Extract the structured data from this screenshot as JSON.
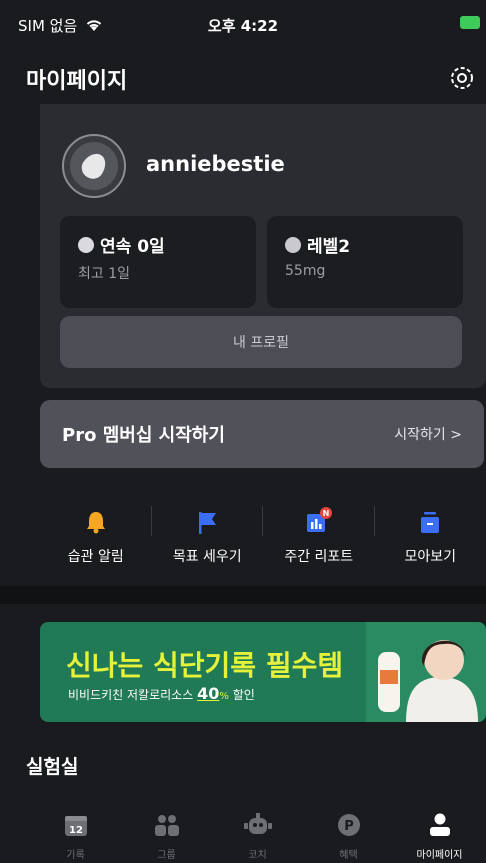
{
  "status": {
    "carrier": "SIM 없음",
    "time": "오후 4:22"
  },
  "header": {
    "title": "마이페이지"
  },
  "profile": {
    "username": "anniebestie",
    "streak": {
      "label": "연속 0일",
      "sub": "최고 1일"
    },
    "level": {
      "label": "레벨2",
      "sub": "55mg"
    },
    "profile_button": "내 프로필"
  },
  "pro": {
    "title": "Pro 멤버십 시작하기",
    "cta": "시작하기 >"
  },
  "quick_actions": [
    {
      "label": "습관 알림",
      "icon": "bell-icon"
    },
    {
      "label": "목표 세우기",
      "icon": "flag-icon"
    },
    {
      "label": "주간 리포트",
      "icon": "report-icon"
    },
    {
      "label": "모아보기",
      "icon": "collection-icon"
    }
  ],
  "ad": {
    "headline": "신나는 식단기록 필수템",
    "sub_before": "비비드키친 저칼로리소스",
    "percent": "40",
    "sub_after": "할인"
  },
  "lab_title": "실험실",
  "tabs": [
    {
      "label": "기록",
      "icon": "calendar-icon",
      "badge": "12"
    },
    {
      "label": "그룹",
      "icon": "group-icon"
    },
    {
      "label": "코치",
      "icon": "robot-icon"
    },
    {
      "label": "혜택",
      "icon": "point-icon",
      "badge": "P"
    },
    {
      "label": "마이페이지",
      "icon": "user-icon"
    }
  ],
  "colors": {
    "accent_yellow": "#f5a623",
    "accent_blue": "#3b6ef5",
    "ad_green": "#1f7a55",
    "ad_yellow": "#e6f23a"
  }
}
